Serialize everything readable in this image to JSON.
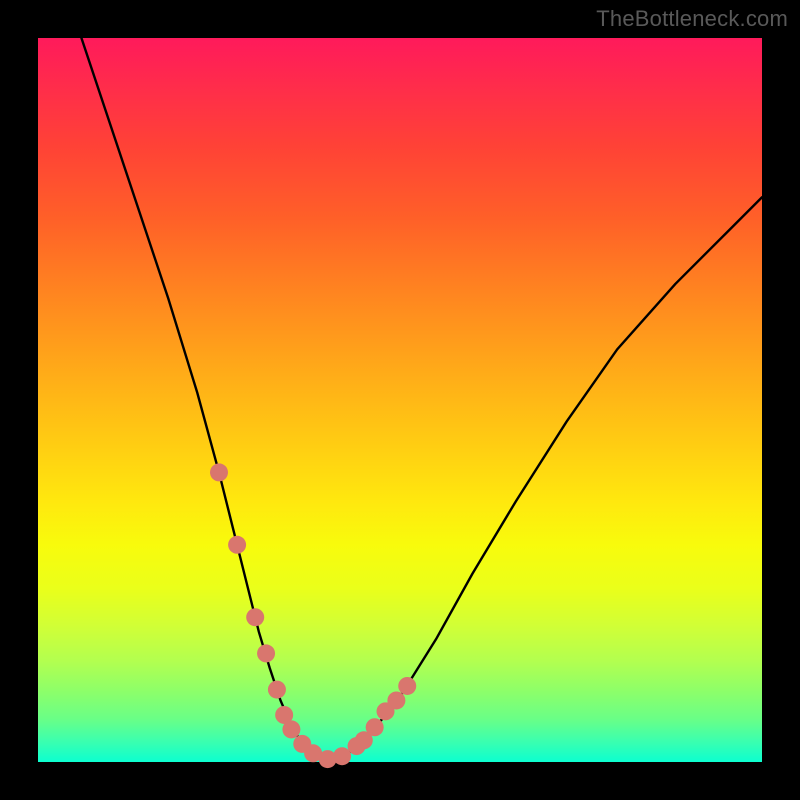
{
  "watermark": "TheBottleneck.com",
  "chart_data": {
    "type": "line",
    "title": "",
    "xlabel": "",
    "ylabel": "",
    "xlim": [
      0,
      100
    ],
    "ylim": [
      0,
      100
    ],
    "grid": false,
    "legend": false,
    "curve": {
      "name": "bottleneck-curve",
      "x": [
        6,
        10,
        14,
        18,
        22,
        25,
        27,
        29,
        30.5,
        32,
        33.5,
        35,
        36.5,
        38,
        40,
        42,
        45,
        50,
        55,
        60,
        66,
        73,
        80,
        88,
        96,
        100
      ],
      "y": [
        100,
        88,
        76,
        64,
        51,
        40,
        32,
        24,
        18,
        13,
        8.5,
        5,
        2.5,
        1.2,
        0.3,
        0.6,
        2.8,
        9,
        17,
        26,
        36,
        47,
        57,
        66,
        74,
        78
      ]
    },
    "markers": {
      "name": "highlighted-points",
      "color": "#d9766e",
      "radius": 9,
      "x": [
        25.0,
        27.5,
        30.0,
        31.5,
        33.0,
        34.0,
        35.0,
        36.5,
        38.0,
        40.0,
        42.0,
        44.0,
        45.0,
        46.5,
        48.0,
        49.5,
        51.0
      ],
      "y": [
        40.0,
        30.0,
        20.0,
        15.0,
        10.0,
        6.5,
        4.5,
        2.5,
        1.2,
        0.4,
        0.8,
        2.2,
        3.0,
        4.8,
        7.0,
        8.5,
        10.5
      ]
    }
  }
}
